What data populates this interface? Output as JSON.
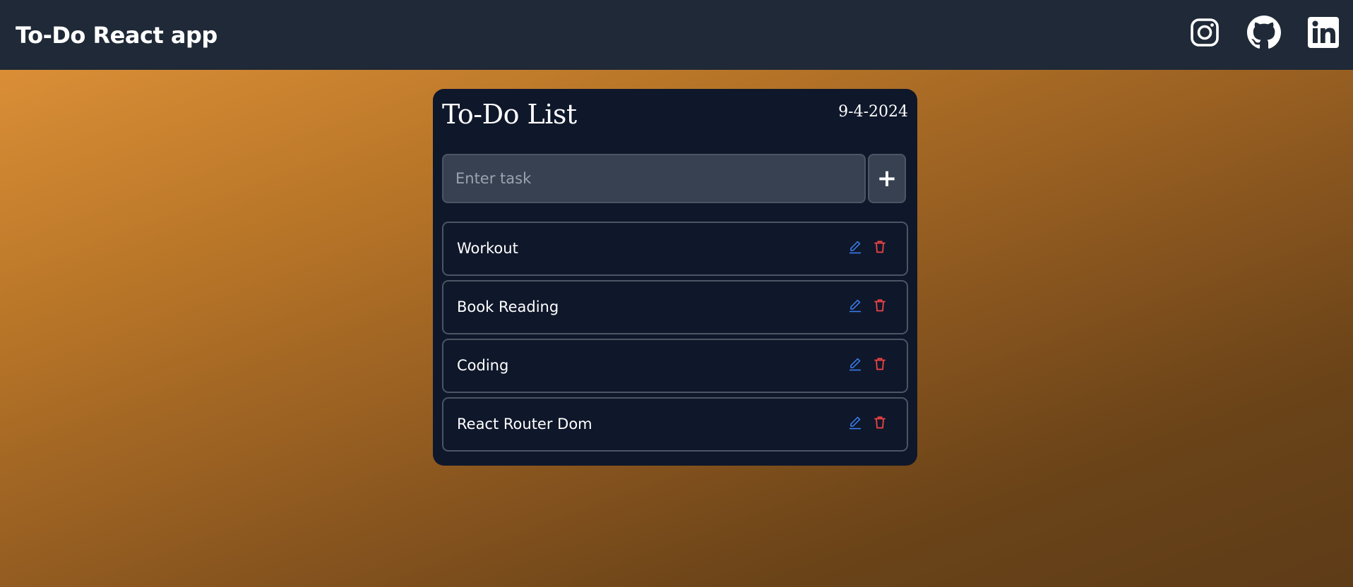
{
  "navbar": {
    "brand": "To-Do React app",
    "social_icons": [
      "instagram-icon",
      "github-icon",
      "linkedin-icon"
    ]
  },
  "card": {
    "title": "To-Do List",
    "date": "9-4-2024",
    "input": {
      "placeholder": "Enter task",
      "value": ""
    },
    "add_button_label": "+",
    "tasks": [
      {
        "text": "Workout"
      },
      {
        "text": "Book Reading"
      },
      {
        "text": "Coding"
      },
      {
        "text": "React Router Dom"
      }
    ],
    "task_action_icons": [
      "edit-icon",
      "trash-icon"
    ]
  },
  "colors": {
    "navbar_bg": "#1f2937",
    "card_bg": "#0f172a",
    "input_bg": "#374151",
    "border": "#4b5563",
    "edit_icon": "#3b82f6",
    "delete_icon": "#ef4444",
    "background_gradient_start": "#e3953a",
    "background_gradient_end": "#5e3c18"
  }
}
